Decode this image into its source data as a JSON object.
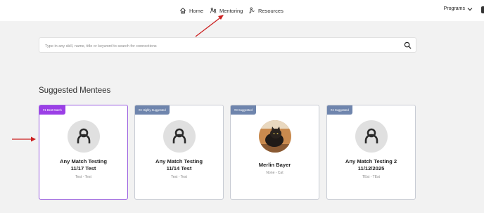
{
  "nav": {
    "home_label": "Home",
    "mentoring_label": "Mentoring",
    "resources_label": "Resources",
    "programs_label": "Programs"
  },
  "search": {
    "placeholder": "Type in any skill, name, title or keyword to search for connections"
  },
  "section": {
    "title": "Suggested Mentees"
  },
  "cards": [
    {
      "badge": "#1 Best Match",
      "name_line1": "Any Match Testing",
      "name_line2": "11/17 Test",
      "subtitle": "Test - Test",
      "avatar": "placeholder-person-icon"
    },
    {
      "badge": "#2 Highly Suggested",
      "name_line1": "Any Match Testing",
      "name_line2": "11/14 Test",
      "subtitle": "Test - Test",
      "avatar": "placeholder-person-icon"
    },
    {
      "badge": "#3 Suggested",
      "name_line1": "Merlin Bayer",
      "name_line2": "",
      "subtitle": "None - Cat",
      "avatar": "cat-photo"
    },
    {
      "badge": "#4 Suggested",
      "name_line1": "Any Match Testing 2",
      "name_line2": "11/12/2025",
      "subtitle": "TEst - TEst",
      "avatar": "placeholder-person-icon"
    }
  ],
  "colors": {
    "accent_purple": "#9b3fe6",
    "badge_blue": "#6f85ad",
    "annotation_red": "#cc1f1f"
  }
}
